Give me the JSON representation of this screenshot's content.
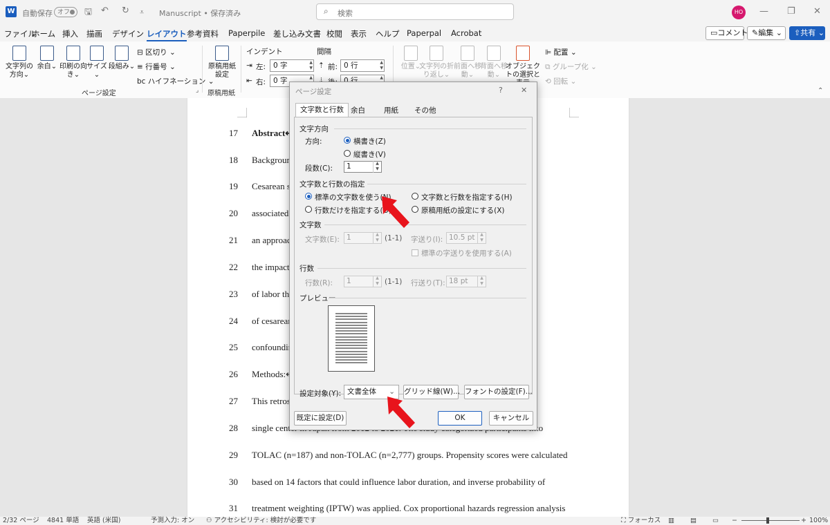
{
  "titlebar": {
    "app_icon": "W",
    "autosave_label": "自動保存",
    "autosave_state": "オフ",
    "doc_title": "Manuscript • 保存済み",
    "search_placeholder": "検索",
    "user_initials": "HO"
  },
  "menu": {
    "tabs": [
      "ファイル",
      "ホーム",
      "挿入",
      "描画",
      "デザイン",
      "レイアウト",
      "参考資料",
      "Paperpile",
      "差し込み文書",
      "校閲",
      "表示",
      "ヘルプ",
      "Paperpal",
      "Acrobat"
    ],
    "active_tab": "レイアウト",
    "comment_btn": "コメント",
    "edit_btn": "編集",
    "share_btn": "共有"
  },
  "ribbon": {
    "page_setup": {
      "buttons": [
        "文字列の方向",
        "余白",
        "印刷の向き",
        "サイズ",
        "段組み"
      ],
      "small": [
        "区切り",
        "行番号",
        "ハイフネーション"
      ],
      "group_label": "ページ設定"
    },
    "genko": {
      "button": "原稿用紙設定",
      "group_label": "原稿用紙"
    },
    "indent": {
      "label": "インデント",
      "left_label": "左:",
      "left_value": "0 字",
      "right_label": "右:",
      "right_value": "0 字"
    },
    "spacing": {
      "label": "間隔",
      "before_label": "前:",
      "before_value": "0 行",
      "after_label": "後:",
      "after_value": "0 行"
    },
    "arrange": {
      "buttons": [
        "位置",
        "文字列の折り返し",
        "前面へ移動",
        "背面へ移動",
        "オブジェクトの選択と表示"
      ],
      "small": [
        "配置",
        "グループ化",
        "回転"
      ]
    }
  },
  "document": {
    "lines": [
      {
        "n": "17",
        "t": "Abstract↵"
      },
      {
        "n": "18",
        "t": "Backgroun"
      },
      {
        "n": "19",
        "t": "Cesarean s                                                                                         ns are"
      },
      {
        "n": "20",
        "t": "associated                                                                                       LAC) is"
      },
      {
        "n": "21",
        "t": "an approac                                                                                      xists on"
      },
      {
        "n": "22",
        "t": "the impact                                                                                       nation"
      },
      {
        "n": "23",
        "t": "of labor th                                                                                     e impact"
      },
      {
        "n": "24",
        "t": "of cesarean                                                                                    itial"
      },
      {
        "n": "25",
        "t": "confoundin"
      },
      {
        "n": "26",
        "t": "Methods:↵"
      },
      {
        "n": "27",
        "t": "This retros                                                                                      rth at a"
      },
      {
        "n": "28",
        "t": "single center in Japan from 2012 to 2021. The study categorized participants into"
      },
      {
        "n": "29",
        "t": "TOLAC (n=187) and non-TOLAC (n=2,777) groups. Propensity scores were calculated"
      },
      {
        "n": "30",
        "t": "based on 14 factors that could influence labor duration, and inverse probability of"
      },
      {
        "n": "31",
        "t": "treatment weighting (IPTW) was applied. Cox proportional hazards regression analysis"
      }
    ]
  },
  "status": {
    "page": "2/32 ページ",
    "words": "4841 単語",
    "lang": "英語 (米国)",
    "predict": "予測入力: オン",
    "access": "アクセシビリティ: 検討が必要です",
    "focus": "フォーカス",
    "zoom": "100%"
  },
  "dialog": {
    "title": "ページ設定",
    "help": "?",
    "close": "✕",
    "tabs": [
      "文字数と行数",
      "余白",
      "用紙",
      "その他"
    ],
    "direction": {
      "section": "文字方向",
      "label": "方向:",
      "opt1": "横書き(Z)",
      "opt2": "縦書き(V)",
      "columns_label": "段数(C):",
      "columns_value": "1"
    },
    "grid": {
      "section": "文字数と行数の指定",
      "opt1": "標準の文字数を使う(N)",
      "opt2": "文字数と行数を指定する(H)",
      "opt3": "行数だけを指定する(O)",
      "opt4": "原稿用紙の設定にする(X)"
    },
    "chars": {
      "section": "文字数",
      "count_label": "文字数(E):",
      "count_value": "1",
      "count_range": "(1-1)",
      "pitch_label": "字送り(I):",
      "pitch_value": "10.5 pt",
      "std_pitch": "標準の字送りを使用する(A)"
    },
    "lines": {
      "section": "行数",
      "count_label": "行数(R):",
      "count_value": "1",
      "count_range": "(1-1)",
      "pitch_label": "行送り(T):",
      "pitch_value": "18 pt"
    },
    "preview": {
      "section": "プレビュー"
    },
    "apply_label": "設定対象(Y):",
    "apply_value": "文書全体",
    "grid_btn": "グリッド線(W)...",
    "font_btn": "フォントの設定(F)...",
    "default_btn": "既定に設定(D)",
    "ok_btn": "OK",
    "cancel_btn": "キャンセル"
  },
  "colors": {
    "accent": "#1b5ebe",
    "arrow": "#e8141c",
    "avatar": "#d6186e"
  }
}
